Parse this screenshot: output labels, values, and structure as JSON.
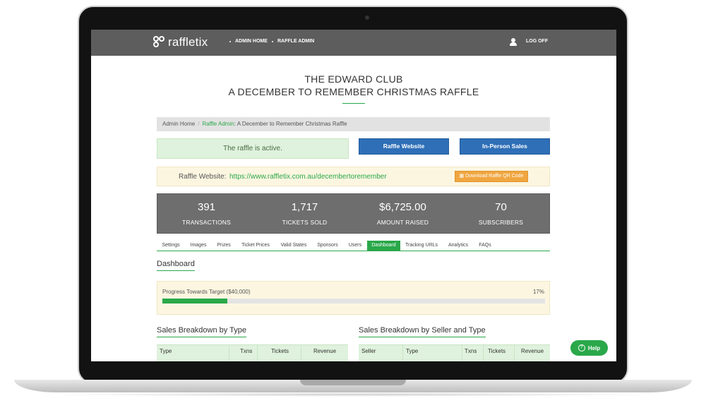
{
  "nav": {
    "brand": "raffletix",
    "links": [
      "ADMIN HOME",
      "RAFFLE ADMIN"
    ],
    "logoff": "LOG OFF"
  },
  "header": {
    "club": "THE EDWARD CLUB",
    "raffle": "A DECEMBER TO REMEMBER CHRISTMAS RAFFLE"
  },
  "breadcrumb": {
    "home": "Admin Home",
    "separator": "/",
    "raffle_admin": "Raffle Admin",
    "current": ": A December to Remember Christmas Raffle"
  },
  "status": {
    "text": "The raffle is active."
  },
  "buttons": {
    "website": "Raffle Website",
    "in_person": "In-Person Sales"
  },
  "website": {
    "label": "Raffle Website:",
    "url": "https://www.raffletix.com.au/decembertoremember",
    "qr_button": "Download Raffle QR Code"
  },
  "stats": [
    {
      "value": "391",
      "label": "TRANSACTIONS"
    },
    {
      "value": "1,717",
      "label": "TICKETS SOLD"
    },
    {
      "value": "$6,725.00",
      "label": "AMOUNT RAISED"
    },
    {
      "value": "70",
      "label": "SUBSCRIBERS"
    }
  ],
  "tabs": [
    "Settings",
    "Images",
    "Prizes",
    "Ticket Prices",
    "Valid States",
    "Sponsors",
    "Users",
    "Dashboard",
    "Tracking URLs",
    "Analytics",
    "FAQs"
  ],
  "active_tab": "Dashboard",
  "dashboard": {
    "heading": "Dashboard",
    "progress_label": "Progress Towards Target ($40,000)",
    "progress_text": "17%",
    "progress_fraction": 0.17
  },
  "tables": {
    "by_type": {
      "heading": "Sales Breakdown by Type",
      "columns": [
        "Type",
        "Txns",
        "Tickets",
        "Revenue"
      ]
    },
    "by_seller": {
      "heading": "Sales Breakdown by Seller and Type",
      "columns": [
        "Seller",
        "Type",
        "Txns",
        "Tickets",
        "Revenue"
      ]
    }
  },
  "help": {
    "label": "Help"
  },
  "colors": {
    "brand_green": "#2aa84a",
    "nav_gray": "#5d5d5d",
    "button_blue": "#2e6fb7",
    "qr_orange": "#f0a640"
  }
}
